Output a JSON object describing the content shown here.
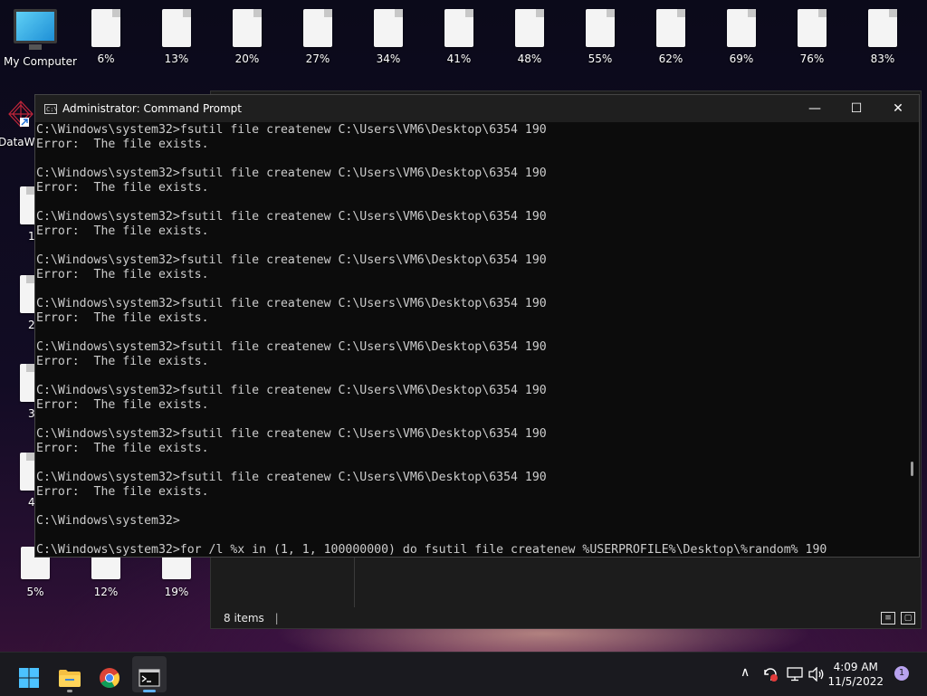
{
  "desktop": {
    "my_computer_label": "My Computer",
    "dataw_label": "DataW",
    "top_files": [
      "6%",
      "13%",
      "20%",
      "27%",
      "34%",
      "41%",
      "48%",
      "55%",
      "62%",
      "69%",
      "76%",
      "83%"
    ],
    "bottom_files": [
      "5%",
      "12%",
      "19%"
    ],
    "left_partial_labels": [
      "1",
      "2",
      "3",
      "4"
    ]
  },
  "explorer": {
    "status_text": "8 items"
  },
  "cmd": {
    "title": "Administrator: Command Prompt",
    "app_icon_text": "C:\\",
    "min_symbol": "—",
    "max_symbol": "☐",
    "close_symbol": "✕",
    "lines": [
      "C:\\Windows\\system32>fsutil file createnew C:\\Users\\VM6\\Desktop\\6354 190",
      "Error:  The file exists.",
      "",
      "C:\\Windows\\system32>fsutil file createnew C:\\Users\\VM6\\Desktop\\6354 190",
      "Error:  The file exists.",
      "",
      "C:\\Windows\\system32>fsutil file createnew C:\\Users\\VM6\\Desktop\\6354 190",
      "Error:  The file exists.",
      "",
      "C:\\Windows\\system32>fsutil file createnew C:\\Users\\VM6\\Desktop\\6354 190",
      "Error:  The file exists.",
      "",
      "C:\\Windows\\system32>fsutil file createnew C:\\Users\\VM6\\Desktop\\6354 190",
      "Error:  The file exists.",
      "",
      "C:\\Windows\\system32>fsutil file createnew C:\\Users\\VM6\\Desktop\\6354 190",
      "Error:  The file exists.",
      "",
      "C:\\Windows\\system32>fsutil file createnew C:\\Users\\VM6\\Desktop\\6354 190",
      "Error:  The file exists.",
      "",
      "C:\\Windows\\system32>fsutil file createnew C:\\Users\\VM6\\Desktop\\6354 190",
      "Error:  The file exists.",
      "",
      "C:\\Windows\\system32>fsutil file createnew C:\\Users\\VM6\\Desktop\\6354 190",
      "Error:  The file exists.",
      "",
      "C:\\Windows\\system32>",
      "",
      "C:\\Windows\\system32>for /l %x in (1, 1, 100000000) do fsutil file createnew %USERPROFILE%\\Desktop\\%random% 190"
    ]
  },
  "taskbar": {
    "apps": [
      "start",
      "file-explorer",
      "chrome",
      "command-prompt"
    ],
    "clock_time": "4:09 AM",
    "clock_date": "11/5/2022",
    "notification_count": "1",
    "chevron": "∧"
  }
}
